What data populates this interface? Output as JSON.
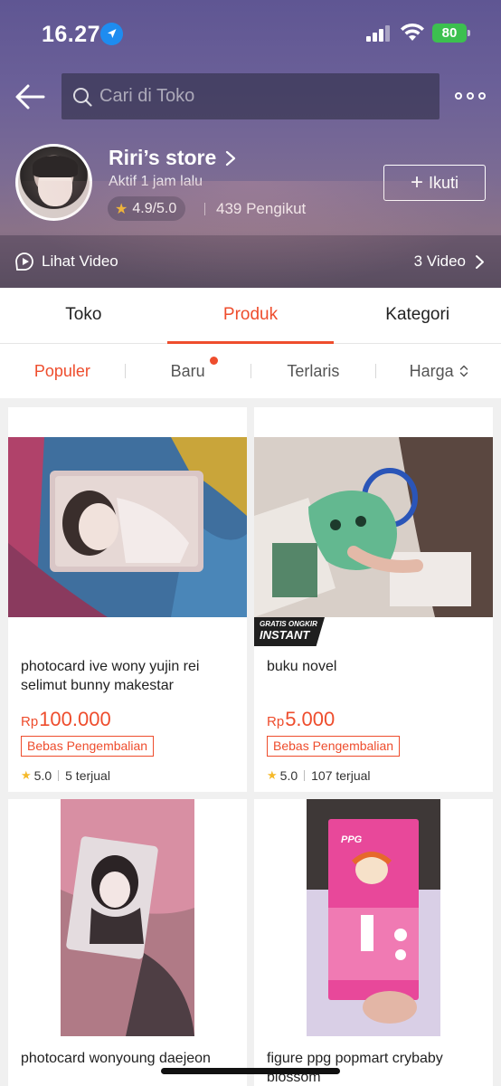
{
  "status_bar": {
    "time": "16.27",
    "battery": "80"
  },
  "search": {
    "placeholder": "Cari di Toko"
  },
  "store": {
    "name": "Riri’s store",
    "active": "Aktif 1 jam lalu",
    "rating": "4.9/5.0",
    "followers": "439 Pengikut",
    "follow_label": "Ikuti"
  },
  "video_bar": {
    "label": "Lihat Video",
    "count": "3 Video"
  },
  "tabs": [
    {
      "label": "Toko"
    },
    {
      "label": "Produk",
      "active": true
    },
    {
      "label": "Kategori"
    }
  ],
  "sort": [
    {
      "label": "Populer",
      "active": true
    },
    {
      "label": "Baru"
    },
    {
      "label": "Terlaris"
    },
    {
      "label": "Harga"
    }
  ],
  "products": [
    {
      "title": "photocard ive wony yujin rei selimut bunny makestar",
      "price_prefix": "Rp",
      "price": "100.000",
      "badge": "Bebas Pengembalian",
      "rating": "5.0",
      "sold": "5 terjual"
    },
    {
      "title": "buku novel",
      "price_prefix": "Rp",
      "price": "5.000",
      "badge": "Bebas Pengembalian",
      "rating": "5.0",
      "sold": "107 terjual",
      "free_shipping_top": "GRATIS ONGKIR",
      "free_shipping_bottom": "INSTANT"
    },
    {
      "title": "photocard wonyoung daejeon"
    },
    {
      "title": "figure ppg popmart crybaby blossom"
    }
  ],
  "colors": {
    "accent": "#ee4d2d",
    "star": "#f5b92a",
    "battery": "#3cc04f"
  }
}
